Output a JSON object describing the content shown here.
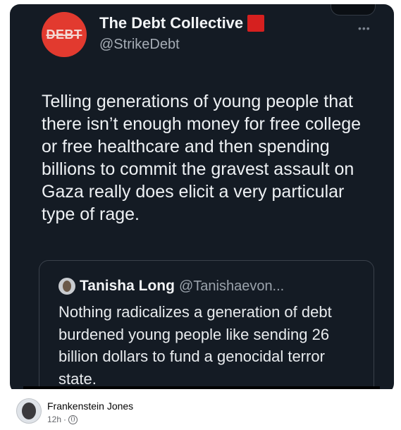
{
  "tweet": {
    "avatar_text": "DEBT",
    "author_name": "The Debt Collective",
    "author_handle": "@StrikeDebt",
    "text": "Telling generations of young people that there isn’t enough money for free college or free healthcare and then spending billions to commit the gravest assault on Gaza really does elicit a very particular type of rage."
  },
  "quoted": {
    "author_name": "Tanisha Long",
    "author_handle": "@Tanishaevon...",
    "text": "Nothing radicalizes a generation of debt burdened young people like sending 26 billion dollars to fund a genocidal terror state."
  },
  "fb_post": {
    "poster_name": "Frankenstein Jones",
    "time": "12h",
    "separator": "·"
  },
  "colors": {
    "post_bg": "#141b24",
    "avatar_red": "#e23a2f",
    "flag_red": "#d6201f"
  }
}
